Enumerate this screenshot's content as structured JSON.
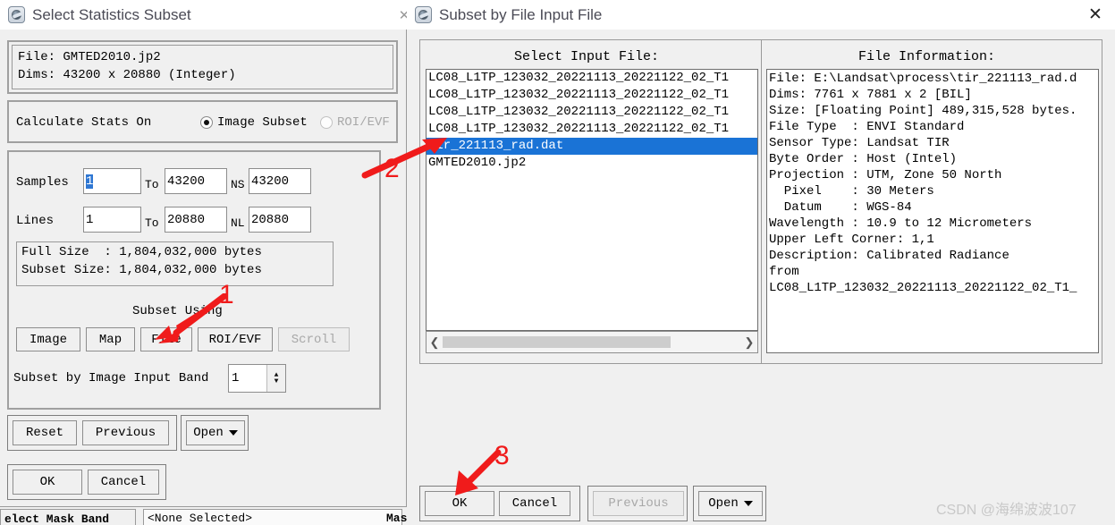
{
  "left_dialog": {
    "title": "Select Statistics Subset",
    "icon": "envi-globe-icon",
    "file_info": {
      "line1": "File: GMTED2010.jp2",
      "line2": "Dims: 43200 x 20880 (Integer)"
    },
    "calc_stats": {
      "label": "Calculate Stats On",
      "option_image_subset": "Image Subset",
      "option_roi_evf": "ROI/EVF",
      "selected": "Image Subset"
    },
    "samples": {
      "label": "Samples",
      "from": "1",
      "to_label": "To",
      "to": "43200",
      "ns_label": "NS",
      "ns": "43200"
    },
    "lines": {
      "label": "Lines",
      "from": "1",
      "to_label": "To",
      "to": "20880",
      "nl_label": "NL",
      "nl": "20880"
    },
    "sizes": {
      "full": "Full Size  : 1,804,032,000 bytes",
      "subset": "Subset Size: 1,804,032,000 bytes"
    },
    "subset_using": {
      "label": "Subset Using",
      "buttons": [
        {
          "label": "Image",
          "disabled": false
        },
        {
          "label": "Map",
          "disabled": false
        },
        {
          "label": "File",
          "disabled": false
        },
        {
          "label": "ROI/EVF",
          "disabled": false
        },
        {
          "label": "Scroll",
          "disabled": true
        }
      ]
    },
    "input_band": {
      "label": "Subset by Image Input Band",
      "value": "1"
    },
    "action_row": {
      "reset": "Reset",
      "previous": "Previous",
      "open": "Open"
    },
    "ok_row": {
      "ok": "OK",
      "cancel": "Cancel"
    }
  },
  "right_dialog": {
    "title": "Subset by File Input File",
    "icon": "envi-globe-icon",
    "close_icon": "close-icon",
    "select_input_file": {
      "header": "Select Input File:",
      "items": [
        {
          "label": "LC08_L1TP_123032_20221113_20221122_02_T1",
          "selected": false
        },
        {
          "label": "LC08_L1TP_123032_20221113_20221122_02_T1",
          "selected": false
        },
        {
          "label": "LC08_L1TP_123032_20221113_20221122_02_T1",
          "selected": false
        },
        {
          "label": "LC08_L1TP_123032_20221113_20221122_02_T1",
          "selected": false
        },
        {
          "label": "tir_221113_rad.dat",
          "selected": true
        },
        {
          "label": "GMTED2010.jp2",
          "selected": false
        }
      ],
      "scroll_left_icon": "chevron-left-icon",
      "scroll_right_icon": "chevron-right-icon"
    },
    "file_information": {
      "header": "File Information:",
      "lines": [
        "File: E:\\Landsat\\process\\tir_221113_rad.d",
        "Dims: 7761 x 7881 x 2 [BIL]",
        "Size: [Floating Point] 489,315,528 bytes.",
        "File Type  : ENVI Standard",
        "Sensor Type: Landsat TIR",
        "Byte Order : Host (Intel)",
        "Projection : UTM, Zone 50 North",
        "  Pixel    : 30 Meters",
        "  Datum    : WGS-84",
        "Wavelength : 10.9 to 12 Micrometers",
        "Upper Left Corner: 1,1",
        "Description: Calibrated Radiance",
        "from",
        "LC08_L1TP_123032_20221113_20221122_02_T1_"
      ]
    },
    "buttons": {
      "ok": "OK",
      "cancel": "Cancel",
      "previous": "Previous",
      "previous_disabled": true,
      "open": "Open"
    }
  },
  "background_window": {
    "mask_band_label": "elect Mask Band",
    "mask_value": "<None Selected>",
    "mask_right": "Mask"
  },
  "annotations": [
    {
      "number": "1",
      "target": "file-subset-button"
    },
    {
      "number": "2",
      "target": "selected-input-file"
    },
    {
      "number": "3",
      "target": "ok-button"
    }
  ],
  "watermark": {
    "text": "CSDN @海绵波波107"
  },
  "colors": {
    "selection_blue": "#1a73d6",
    "annotation_red": "#f01b1b",
    "panel_gray": "#f0f0f0",
    "title_text": "#4a4a55"
  }
}
